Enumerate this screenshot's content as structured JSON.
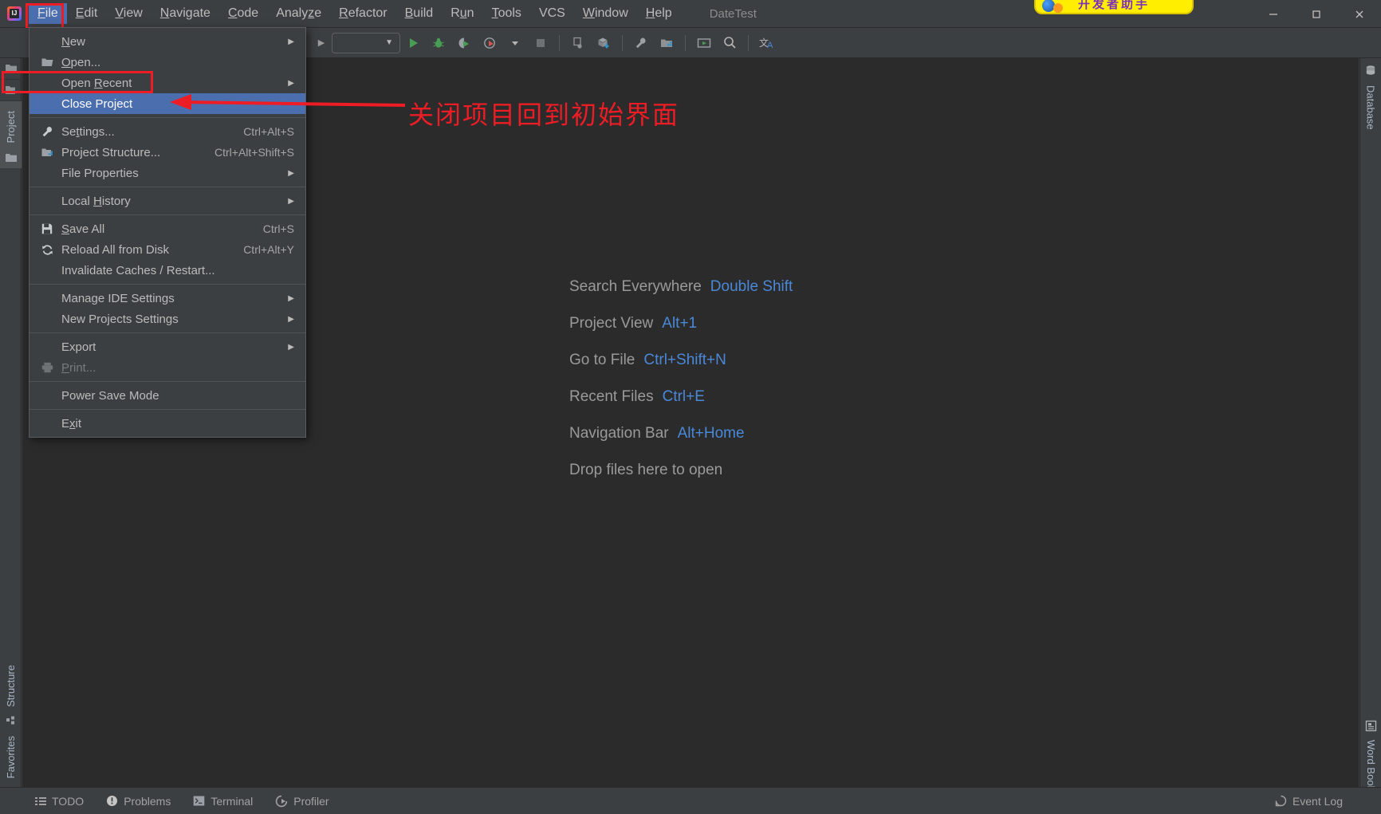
{
  "window": {
    "project_name": "DateTest",
    "controls": {
      "minimize": "─",
      "maximize": "□",
      "close": "✕"
    }
  },
  "menubar": {
    "items": [
      {
        "label": "File",
        "mnemonic": "F",
        "active": true
      },
      {
        "label": "Edit",
        "mnemonic": "E",
        "active": false
      },
      {
        "label": "View",
        "mnemonic": "V",
        "active": false
      },
      {
        "label": "Navigate",
        "mnemonic": "N",
        "active": false
      },
      {
        "label": "Code",
        "mnemonic": "C",
        "active": false
      },
      {
        "label": "Analyze",
        "mnemonic": "z",
        "active": false
      },
      {
        "label": "Refactor",
        "mnemonic": "R",
        "active": false
      },
      {
        "label": "Build",
        "mnemonic": "B",
        "active": false
      },
      {
        "label": "Run",
        "mnemonic": "u",
        "active": false
      },
      {
        "label": "Tools",
        "mnemonic": "T",
        "active": false
      },
      {
        "label": "VCS",
        "mnemonic": "",
        "active": false
      },
      {
        "label": "Window",
        "mnemonic": "W",
        "active": false
      },
      {
        "label": "Help",
        "mnemonic": "H",
        "active": false
      }
    ]
  },
  "banner": {
    "text": "开发者助手",
    "bg_color": "#ffee00",
    "text_color": "#7b2fbe"
  },
  "toolbar": {
    "icons": [
      "run-configuration-combo",
      "run-icon",
      "debug-icon",
      "run-with-coverage-icon",
      "profile-icon",
      "dropdown-caret-icon",
      "stop-icon",
      "attach-debugger-icon",
      "update-project-icon",
      "settings-wrench-icon",
      "project-structure-icon",
      "presentation-icon",
      "search-icon",
      "translate-icon"
    ]
  },
  "file_menu": {
    "rows": [
      {
        "type": "item",
        "label": "New",
        "mnemonic": "N",
        "icon": null,
        "shortcut": "",
        "submenu": true,
        "selected": false,
        "disabled": false
      },
      {
        "type": "item",
        "label": "Open...",
        "mnemonic": "O",
        "icon": "folder-open-icon",
        "shortcut": "",
        "submenu": false,
        "selected": false,
        "disabled": false
      },
      {
        "type": "item",
        "label": "Open Recent",
        "mnemonic": "R",
        "icon": null,
        "shortcut": "",
        "submenu": true,
        "selected": false,
        "disabled": false
      },
      {
        "type": "item",
        "label": "Close Project",
        "mnemonic": "",
        "icon": null,
        "shortcut": "",
        "submenu": false,
        "selected": true,
        "disabled": false
      },
      {
        "type": "separator"
      },
      {
        "type": "item",
        "label": "Settings...",
        "mnemonic": "t",
        "icon": "wrench-icon",
        "shortcut": "Ctrl+Alt+S",
        "submenu": false,
        "selected": false,
        "disabled": false
      },
      {
        "type": "item",
        "label": "Project Structure...",
        "mnemonic": "",
        "icon": "project-structure-icon",
        "shortcut": "Ctrl+Alt+Shift+S",
        "submenu": false,
        "selected": false,
        "disabled": false
      },
      {
        "type": "item",
        "label": "File Properties",
        "mnemonic": "",
        "icon": null,
        "shortcut": "",
        "submenu": true,
        "selected": false,
        "disabled": false
      },
      {
        "type": "separator"
      },
      {
        "type": "item",
        "label": "Local History",
        "mnemonic": "H",
        "icon": null,
        "shortcut": "",
        "submenu": true,
        "selected": false,
        "disabled": false
      },
      {
        "type": "separator"
      },
      {
        "type": "item",
        "label": "Save All",
        "mnemonic": "S",
        "icon": "save-icon",
        "shortcut": "Ctrl+S",
        "submenu": false,
        "selected": false,
        "disabled": false
      },
      {
        "type": "item",
        "label": "Reload All from Disk",
        "mnemonic": "",
        "icon": "reload-icon",
        "shortcut": "Ctrl+Alt+Y",
        "submenu": false,
        "selected": false,
        "disabled": false
      },
      {
        "type": "item",
        "label": "Invalidate Caches / Restart...",
        "mnemonic": "",
        "icon": null,
        "shortcut": "",
        "submenu": false,
        "selected": false,
        "disabled": false
      },
      {
        "type": "separator"
      },
      {
        "type": "item",
        "label": "Manage IDE Settings",
        "mnemonic": "",
        "icon": null,
        "shortcut": "",
        "submenu": true,
        "selected": false,
        "disabled": false
      },
      {
        "type": "item",
        "label": "New Projects Settings",
        "mnemonic": "",
        "icon": null,
        "shortcut": "",
        "submenu": true,
        "selected": false,
        "disabled": false
      },
      {
        "type": "separator"
      },
      {
        "type": "item",
        "label": "Export",
        "mnemonic": "",
        "icon": null,
        "shortcut": "",
        "submenu": true,
        "selected": false,
        "disabled": false
      },
      {
        "type": "item",
        "label": "Print...",
        "mnemonic": "P",
        "icon": "printer-icon",
        "shortcut": "",
        "submenu": false,
        "selected": false,
        "disabled": true
      },
      {
        "type": "separator"
      },
      {
        "type": "item",
        "label": "Power Save Mode",
        "mnemonic": "",
        "icon": null,
        "shortcut": "",
        "submenu": false,
        "selected": false,
        "disabled": false
      },
      {
        "type": "separator"
      },
      {
        "type": "item",
        "label": "Exit",
        "mnemonic": "x",
        "icon": null,
        "shortcut": "",
        "submenu": false,
        "selected": false,
        "disabled": false
      }
    ]
  },
  "annotation": {
    "text": "关闭项目回到初始界面",
    "color": "#ee1c25"
  },
  "welcome": {
    "shortcuts": [
      {
        "label": "Search Everywhere",
        "key": "Double Shift"
      },
      {
        "label": "Project View",
        "key": "Alt+1"
      },
      {
        "label": "Go to File",
        "key": "Ctrl+Shift+N"
      },
      {
        "label": "Recent Files",
        "key": "Ctrl+E"
      },
      {
        "label": "Navigation Bar",
        "key": "Alt+Home"
      },
      {
        "label": "Drop files here to open",
        "key": ""
      }
    ]
  },
  "left_strip": {
    "top_buttons": [
      "folder-open-icon",
      "project-structure-icon"
    ],
    "tabs": [
      {
        "label": "Project",
        "icon": "folder-icon",
        "active": true
      },
      {
        "label": "Structure",
        "icon": "structure-icon",
        "active": false
      },
      {
        "label": "Favorites",
        "icon": "star-icon",
        "active": false
      }
    ]
  },
  "right_strip": {
    "tabs": [
      {
        "label": "Database",
        "icon": "database-icon"
      },
      {
        "label": "Word Book",
        "icon": "book-icon"
      }
    ]
  },
  "statusbar": {
    "items": [
      {
        "label": "TODO",
        "icon": "todo-list-icon"
      },
      {
        "label": "Problems",
        "icon": "problems-icon"
      },
      {
        "label": "Terminal",
        "icon": "terminal-icon"
      },
      {
        "label": "Profiler",
        "icon": "profiler-icon"
      }
    ],
    "right_items": [
      {
        "label": "Event Log",
        "icon": "event-log-icon"
      }
    ]
  }
}
